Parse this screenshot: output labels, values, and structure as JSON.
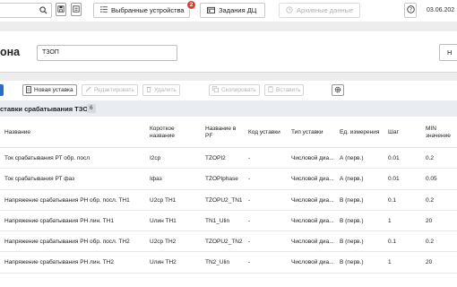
{
  "topbar": {
    "devices_label": "Выбранные устройства",
    "devices_badge": "2",
    "tasks_label": "Задания ДЦ",
    "archive_label": "Архивные данные",
    "date": "03.06.202"
  },
  "header": {
    "title": "она",
    "filter_value": "ТЗОП",
    "right_button": "Н"
  },
  "toolbar": {
    "new_label": "Новая уставка",
    "edit_label": "Редактировать",
    "delete_label": "Удалить",
    "copy_label": "Скопировать",
    "paste_label": "Вставить"
  },
  "section": {
    "title": "ставки срабатывания ТЗОП",
    "count": "6"
  },
  "table": {
    "headers": {
      "name": "Название",
      "short1": "Короткое",
      "short2": "название",
      "pf1": "Название в",
      "pf2": "PF",
      "code": "Код уставки",
      "type": "Тип уставки",
      "unit": "Ед. измерения",
      "step": "Шаг",
      "min1": "MIN",
      "min2": "значение"
    },
    "rows": [
      {
        "name": "Ток срабатывания РТ обр. посл",
        "short": "I2ср",
        "pf": "TZOPI2",
        "code": "-",
        "type": "Числовой диа...",
        "unit": "А (перв.)",
        "step": "0.01",
        "min": "0.2"
      },
      {
        "name": "Ток срабатывания РТ фаз",
        "short": "Iфаз",
        "pf": "TZOPIphase",
        "code": "-",
        "type": "Числовой диа...",
        "unit": "А (перв.)",
        "step": "0.01",
        "min": "0.05"
      },
      {
        "name": "Напряжение срабатывания РН обр. посл. ТН1",
        "short": "U2ср ТН1",
        "pf": "TZOPU2_TN1",
        "code": "-",
        "type": "Числовой диа...",
        "unit": "В (перв.)",
        "step": "0.1",
        "min": "0.2"
      },
      {
        "name": "Напряжение срабатывания РН лин. ТН1",
        "short": "Uлин ТН1",
        "pf": "TN1_Ulin",
        "code": "-",
        "type": "Числовой диа...",
        "unit": "В (перв.)",
        "step": "1",
        "min": "20"
      },
      {
        "name": "Напряжение срабатывания РН обр. посл. ТН2",
        "short": "U2ср ТН2",
        "pf": "TZOPU2_TN2",
        "code": "-",
        "type": "Числовой диа...",
        "unit": "В (перв.)",
        "step": "0.1",
        "min": "0.2"
      },
      {
        "name": "Напряжение срабатывания РН лин. ТН2",
        "short": "Uлин ТН2",
        "pf": "TN2_Ulin",
        "code": "-",
        "type": "Числовой диа...",
        "unit": "В (перв.)",
        "step": "1",
        "min": "20"
      }
    ]
  },
  "icons": {
    "search": "search-icon",
    "save": "save-icon",
    "export": "export-icon",
    "devices": "list-icon",
    "tasks": "calendar-icon",
    "archive": "clock-icon",
    "help": "help-icon",
    "settings": "settings-icon"
  }
}
